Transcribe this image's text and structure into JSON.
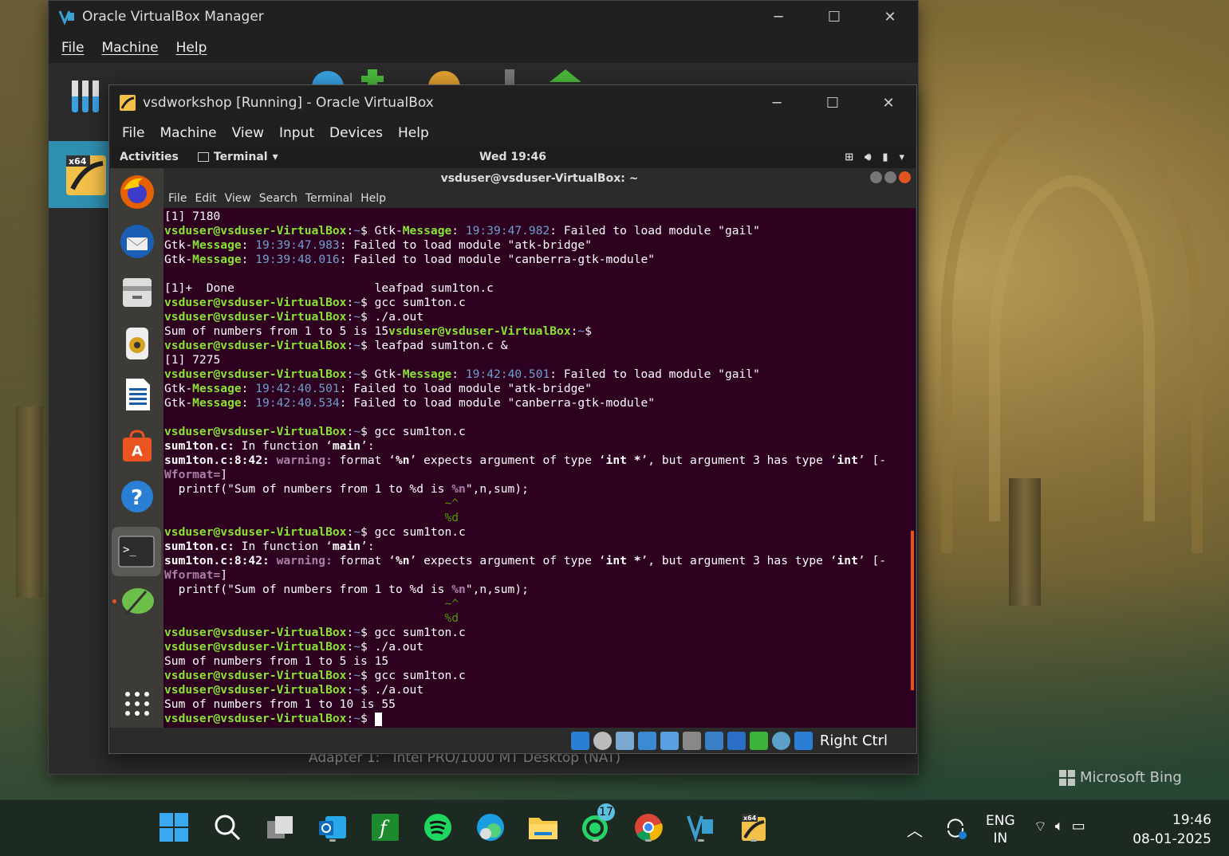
{
  "manager": {
    "title": "Oracle VirtualBox Manager",
    "menu": [
      "File",
      "Machine",
      "Help"
    ],
    "adapter": "Adapter 1:   Intel PRO/1000 MT Desktop (NAT)"
  },
  "vm": {
    "title": "vsdworkshop [Running] - Oracle VirtualBox",
    "menu": [
      "File",
      "Machine",
      "View",
      "Input",
      "Devices",
      "Help"
    ],
    "host_key": "Right Ctrl"
  },
  "guest": {
    "activities": "Activities",
    "app_menu": "Terminal",
    "clock": "Wed 19:46",
    "dock_icons": [
      "firefox-icon",
      "thunderbird-icon",
      "files-icon",
      "rhythmbox-icon",
      "writer-icon",
      "software-icon",
      "help-icon",
      "terminal-icon",
      "leafpad-icon",
      "app-grid-icon"
    ]
  },
  "terminal": {
    "title": "vsduser@vsduser-VirtualBox: ~",
    "menu": [
      "File",
      "Edit",
      "View",
      "Search",
      "Terminal",
      "Help"
    ],
    "lines": [
      [
        [
          "[1] 7180",
          "w"
        ]
      ],
      [
        [
          "vsduser@vsduser-VirtualBox",
          "g"
        ],
        [
          ":",
          "w"
        ],
        [
          "~",
          "b"
        ],
        [
          "$ Gtk-",
          "w"
        ],
        [
          "Message",
          "g"
        ],
        [
          ": ",
          "w"
        ],
        [
          "19:39:47.982",
          "b"
        ],
        [
          ": Failed to load module \"gail\"",
          "w"
        ]
      ],
      [
        [
          "Gtk-",
          "w"
        ],
        [
          "Message",
          "g"
        ],
        [
          ": ",
          "w"
        ],
        [
          "19:39:47.983",
          "b"
        ],
        [
          ": Failed to load module \"atk-bridge\"",
          "w"
        ]
      ],
      [
        [
          "Gtk-",
          "w"
        ],
        [
          "Message",
          "g"
        ],
        [
          ": ",
          "w"
        ],
        [
          "19:39:48.016",
          "b"
        ],
        [
          ": Failed to load module \"canberra-gtk-module\"",
          "w"
        ]
      ],
      [
        [
          "",
          "w"
        ]
      ],
      [
        [
          "[1]+  Done                    leafpad sum1ton.c",
          "w"
        ]
      ],
      [
        [
          "vsduser@vsduser-VirtualBox",
          "g"
        ],
        [
          ":",
          "w"
        ],
        [
          "~",
          "b"
        ],
        [
          "$ gcc sum1ton.c",
          "w"
        ]
      ],
      [
        [
          "vsduser@vsduser-VirtualBox",
          "g"
        ],
        [
          ":",
          "w"
        ],
        [
          "~",
          "b"
        ],
        [
          "$ ./a.out",
          "w"
        ]
      ],
      [
        [
          "Sum of numbers from 1 to 5 is 15",
          "w"
        ],
        [
          "vsduser@vsduser-VirtualBox",
          "g"
        ],
        [
          ":",
          "w"
        ],
        [
          "~",
          "b"
        ],
        [
          "$",
          "w"
        ]
      ],
      [
        [
          "vsduser@vsduser-VirtualBox",
          "g"
        ],
        [
          ":",
          "w"
        ],
        [
          "~",
          "b"
        ],
        [
          "$ leafpad sum1ton.c &",
          "w"
        ]
      ],
      [
        [
          "[1] 7275",
          "w"
        ]
      ],
      [
        [
          "vsduser@vsduser-VirtualBox",
          "g"
        ],
        [
          ":",
          "w"
        ],
        [
          "~",
          "b"
        ],
        [
          "$ Gtk-",
          "w"
        ],
        [
          "Message",
          "g"
        ],
        [
          ": ",
          "w"
        ],
        [
          "19:42:40.501",
          "b"
        ],
        [
          ": Failed to load module \"gail\"",
          "w"
        ]
      ],
      [
        [
          "Gtk-",
          "w"
        ],
        [
          "Message",
          "g"
        ],
        [
          ": ",
          "w"
        ],
        [
          "19:42:40.501",
          "b"
        ],
        [
          ": Failed to load module \"atk-bridge\"",
          "w"
        ]
      ],
      [
        [
          "Gtk-",
          "w"
        ],
        [
          "Message",
          "g"
        ],
        [
          ": ",
          "w"
        ],
        [
          "19:42:40.534",
          "b"
        ],
        [
          ": Failed to load module \"canberra-gtk-module\"",
          "w"
        ]
      ],
      [
        [
          "",
          "w"
        ]
      ],
      [
        [
          "vsduser@vsduser-VirtualBox",
          "g"
        ],
        [
          ":",
          "w"
        ],
        [
          "~",
          "b"
        ],
        [
          "$ gcc sum1ton.c",
          "w"
        ]
      ],
      [
        [
          "sum1ton.c:",
          "W"
        ],
        [
          " In function ‘",
          "w"
        ],
        [
          "main",
          "W"
        ],
        [
          "’:",
          "w"
        ]
      ],
      [
        [
          "sum1ton.c:8:42:",
          "W"
        ],
        [
          " ",
          "w"
        ],
        [
          "warning:",
          "m"
        ],
        [
          " format ‘",
          "w"
        ],
        [
          "%n",
          "W"
        ],
        [
          "’ expects argument of type ‘",
          "w"
        ],
        [
          "int *",
          "W"
        ],
        [
          "’, but argument 3 has type ‘",
          "w"
        ],
        [
          "int",
          "W"
        ],
        [
          "’ [-",
          "w"
        ]
      ],
      [
        [
          "Wformat=",
          "m"
        ],
        [
          "]",
          "w"
        ]
      ],
      [
        [
          "  printf(\"Sum of numbers from 1 to %d is ",
          "w"
        ],
        [
          "%n",
          "m"
        ],
        [
          "\",n,sum);",
          "w"
        ]
      ],
      [
        [
          "                                        ",
          "w"
        ],
        [
          "~^",
          "G"
        ]
      ],
      [
        [
          "                                        ",
          "w"
        ],
        [
          "%d",
          "G"
        ]
      ],
      [
        [
          "vsduser@vsduser-VirtualBox",
          "g"
        ],
        [
          ":",
          "w"
        ],
        [
          "~",
          "b"
        ],
        [
          "$ gcc sum1ton.c",
          "w"
        ]
      ],
      [
        [
          "sum1ton.c:",
          "W"
        ],
        [
          " In function ‘",
          "w"
        ],
        [
          "main",
          "W"
        ],
        [
          "’:",
          "w"
        ]
      ],
      [
        [
          "sum1ton.c:8:42:",
          "W"
        ],
        [
          " ",
          "w"
        ],
        [
          "warning:",
          "m"
        ],
        [
          " format ‘",
          "w"
        ],
        [
          "%n",
          "W"
        ],
        [
          "’ expects argument of type ‘",
          "w"
        ],
        [
          "int *",
          "W"
        ],
        [
          "’, but argument 3 has type ‘",
          "w"
        ],
        [
          "int",
          "W"
        ],
        [
          "’ [-",
          "w"
        ]
      ],
      [
        [
          "Wformat=",
          "m"
        ],
        [
          "]",
          "w"
        ]
      ],
      [
        [
          "  printf(\"Sum of numbers from 1 to %d is ",
          "w"
        ],
        [
          "%n",
          "m"
        ],
        [
          "\",n,sum);",
          "w"
        ]
      ],
      [
        [
          "                                        ",
          "w"
        ],
        [
          "~^",
          "G"
        ]
      ],
      [
        [
          "                                        ",
          "w"
        ],
        [
          "%d",
          "G"
        ]
      ],
      [
        [
          "vsduser@vsduser-VirtualBox",
          "g"
        ],
        [
          ":",
          "w"
        ],
        [
          "~",
          "b"
        ],
        [
          "$ gcc sum1ton.c",
          "w"
        ]
      ],
      [
        [
          "vsduser@vsduser-VirtualBox",
          "g"
        ],
        [
          ":",
          "w"
        ],
        [
          "~",
          "b"
        ],
        [
          "$ ./a.out",
          "w"
        ]
      ],
      [
        [
          "Sum of numbers from 1 to 5 is 15",
          "w"
        ]
      ],
      [
        [
          "vsduser@vsduser-VirtualBox",
          "g"
        ],
        [
          ":",
          "w"
        ],
        [
          "~",
          "b"
        ],
        [
          "$ gcc sum1ton.c",
          "w"
        ]
      ],
      [
        [
          "vsduser@vsduser-VirtualBox",
          "g"
        ],
        [
          ":",
          "w"
        ],
        [
          "~",
          "b"
        ],
        [
          "$ ./a.out",
          "w"
        ]
      ],
      [
        [
          "Sum of numbers from 1 to 10 is 55",
          "w"
        ]
      ],
      [
        [
          "vsduser@vsduser-VirtualBox",
          "g"
        ],
        [
          ":",
          "w"
        ],
        [
          "~",
          "b"
        ],
        [
          "$ ",
          "w"
        ]
      ]
    ],
    "colors": {
      "g": "#8ae234",
      "b": "#729fcf",
      "w": "#ffffff",
      "W": "#ffffff",
      "m": "#ad7fa8",
      "G": "#4e9a06"
    }
  },
  "desktop": {
    "watermark": "Microsoft Bing"
  },
  "taskbar": {
    "whatsapp_badge": "17",
    "lang_top": "ENG",
    "lang_bottom": "IN",
    "time": "19:46",
    "date": "08-01-2025"
  }
}
